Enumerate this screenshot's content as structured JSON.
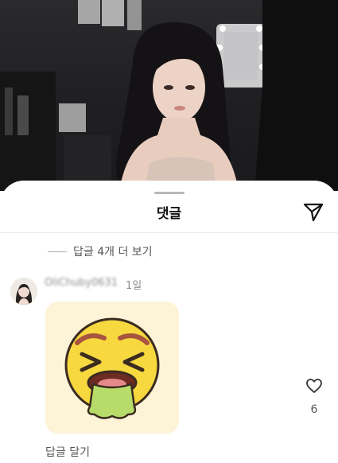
{
  "sheet": {
    "title": "댓글",
    "send_icon": "send-icon"
  },
  "replies": {
    "toggle_label": "답글 4개 더 보기"
  },
  "comment": {
    "username": "OliChuby0631",
    "timestamp": "1일",
    "sticker": "nauseated-face-sticker",
    "reply_label": "답글 달기",
    "like_icon": "heart-icon",
    "like_count": "6"
  },
  "colors": {
    "sticker_background": "#fdf4d8",
    "face_yellow": "#f7d83f",
    "vomit_green": "#b7dc6a"
  }
}
